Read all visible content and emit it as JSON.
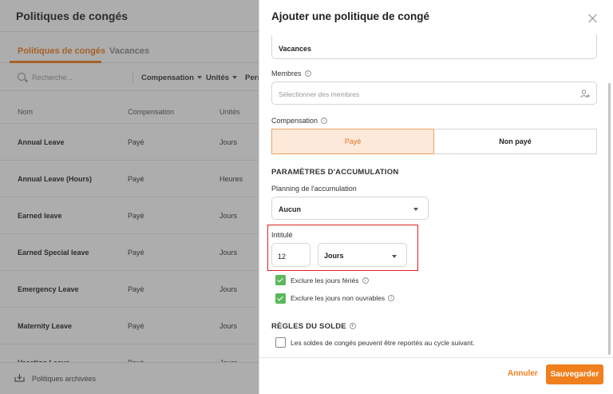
{
  "background": {
    "title": "Politiques de congés",
    "tabs": [
      {
        "label": "Politiques de congés",
        "active": true
      },
      {
        "label": "Vacances",
        "active": false
      }
    ],
    "search_placeholder": "Recherche...",
    "filters": [
      "Compensation",
      "Unités",
      "Pers"
    ],
    "columns": [
      "Nom",
      "Compensation",
      "Unités"
    ],
    "rows": [
      {
        "name": "Annual Leave",
        "compensation": "Payé",
        "units": "Jours"
      },
      {
        "name": "Annual Leave (Hours)",
        "compensation": "Payé",
        "units": "Heures"
      },
      {
        "name": "Earned leave",
        "compensation": "Payé",
        "units": "Jours"
      },
      {
        "name": "Earned Special leave",
        "compensation": "Payé",
        "units": "Jours"
      },
      {
        "name": "Emergency Leave",
        "compensation": "Payé",
        "units": "Jours"
      },
      {
        "name": "Maternity Leave",
        "compensation": "Payé",
        "units": "Jours"
      },
      {
        "name": "Vacation Leave",
        "compensation": "Payé",
        "units": "Jours"
      }
    ],
    "footer_label": "Politiques archivées"
  },
  "panel": {
    "title": "Ajouter une politique de congé",
    "name_value": "Vacances",
    "members": {
      "label": "Membres",
      "placeholder": "Sélectionner des membres"
    },
    "compensation": {
      "label": "Compensation",
      "options": [
        "Payé",
        "Non payé"
      ],
      "selected": "Payé"
    },
    "accrual": {
      "section_title": "PARAMÈTRES D'ACCUMULATION",
      "schedule_label": "Planning de l'accumulation",
      "schedule_value": "Aucun",
      "amount_label": "Intitulé",
      "amount_value": "12",
      "unit_value": "Jours"
    },
    "checks": [
      {
        "label": "Exclure les jours fériés",
        "checked": true
      },
      {
        "label": "Exclure les jours non ouvrables",
        "checked": true
      }
    ],
    "balance": {
      "section_title": "RÈGLES DU SOLDE",
      "carryover_label": "Les soldes de congés peuvent être reportés au cycle suivant.",
      "carryover_checked": false
    },
    "footer": {
      "cancel_label": "Annuler",
      "save_label": "Sauvegarder"
    }
  },
  "colors": {
    "accent": "#f07f1d",
    "check_green": "#5cb85c",
    "highlight_red": "#e02020"
  }
}
